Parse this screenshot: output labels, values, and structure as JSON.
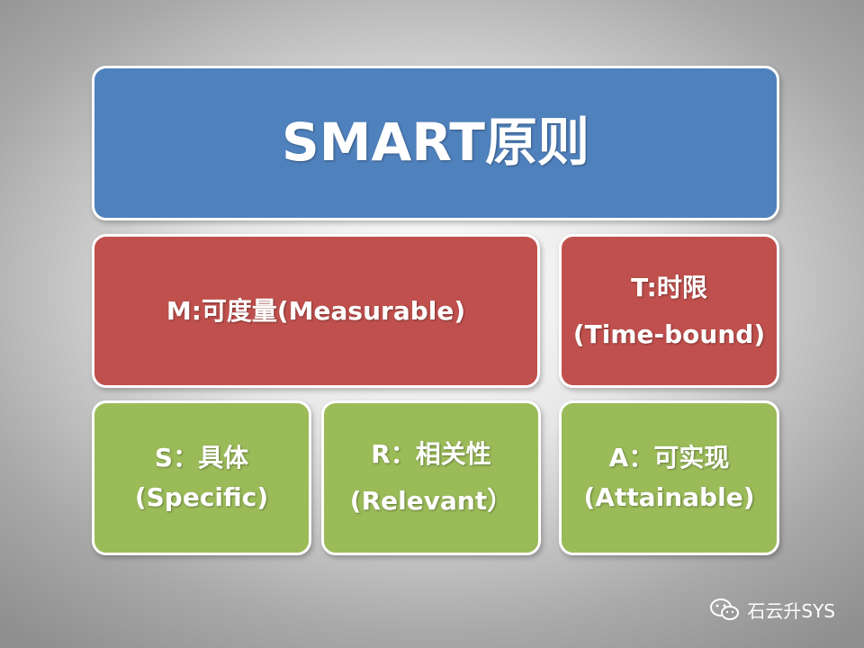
{
  "title": "SMART原则",
  "boxes": {
    "m": {
      "line1": "M:可度量(Measurable)"
    },
    "t": {
      "line1": "T:时限",
      "line2": "(Time-bound)"
    },
    "s": {
      "line1": "S：具体",
      "line2": "(Specific)"
    },
    "r": {
      "line1": "R：相关性",
      "line2": "(Relevant）"
    },
    "a": {
      "line1": "A：可实现",
      "line2": "(Attainable)"
    }
  },
  "watermark": {
    "text": "石云升SYS",
    "icon": "wechat-icon"
  },
  "colors": {
    "blue": "#4f81bd",
    "red": "#c0504d",
    "green": "#9bbb59"
  }
}
